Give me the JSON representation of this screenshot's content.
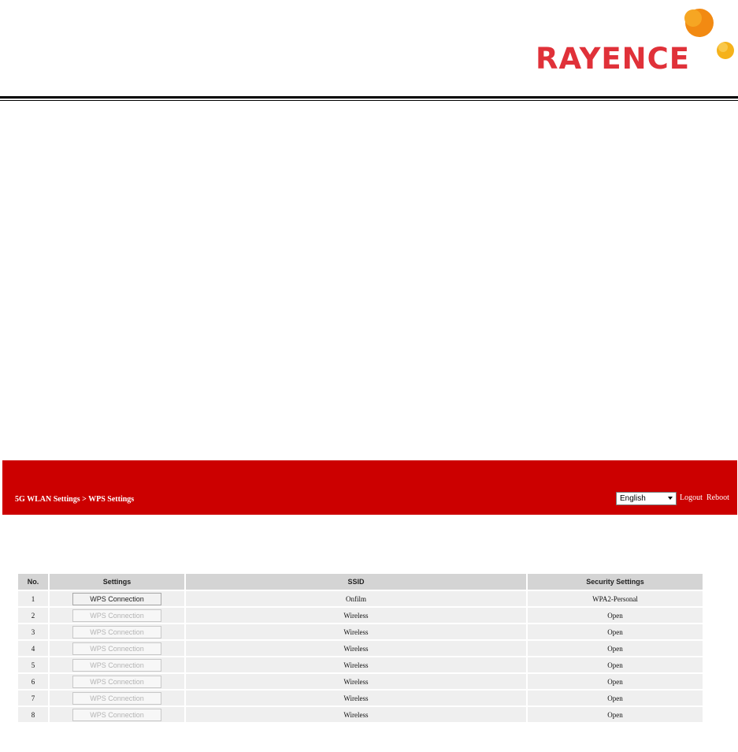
{
  "logo": {
    "text": "RAYENCE"
  },
  "header": {
    "breadcrumb": "5G WLAN Settings > WPS Settings",
    "language": "English",
    "logout": "Logout",
    "reboot": "Reboot",
    "banner_color": "#cc0000"
  },
  "table": {
    "columns": [
      "No.",
      "Settings",
      "SSID",
      "Security Settings"
    ],
    "rows": [
      {
        "no": "1",
        "button": "WPS Connection",
        "ssid": "Onfilm",
        "security": "WPA2-Personal",
        "enabled": true
      },
      {
        "no": "2",
        "button": "WPS Connection",
        "ssid": "Wireless",
        "security": "Open",
        "enabled": false
      },
      {
        "no": "3",
        "button": "WPS Connection",
        "ssid": "Wireless",
        "security": "Open",
        "enabled": false
      },
      {
        "no": "4",
        "button": "WPS Connection",
        "ssid": "Wireless",
        "security": "Open",
        "enabled": false
      },
      {
        "no": "5",
        "button": "WPS Connection",
        "ssid": "Wireless",
        "security": "Open",
        "enabled": false
      },
      {
        "no": "6",
        "button": "WPS Connection",
        "ssid": "Wireless",
        "security": "Open",
        "enabled": false
      },
      {
        "no": "7",
        "button": "WPS Connection",
        "ssid": "Wireless",
        "security": "Open",
        "enabled": false
      },
      {
        "no": "8",
        "button": "WPS Connection",
        "ssid": "Wireless",
        "security": "Open",
        "enabled": false
      }
    ]
  }
}
